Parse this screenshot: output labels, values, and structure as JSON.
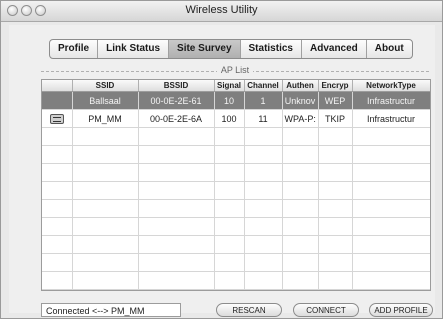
{
  "window": {
    "title": "Wireless Utility"
  },
  "tabs": [
    {
      "label": "Profile"
    },
    {
      "label": "Link Status"
    },
    {
      "label": "Site Survey",
      "active": true
    },
    {
      "label": "Statistics"
    },
    {
      "label": "Advanced"
    },
    {
      "label": "About"
    }
  ],
  "ap_list": {
    "label": "AP List",
    "columns": [
      "",
      "SSID",
      "BSSID",
      "Signal",
      "Channel",
      "Authen",
      "Encryp",
      "NetworkType"
    ],
    "rows": [
      {
        "icon": "",
        "ssid": "Ballsaal",
        "bssid": "00-0E-2E-61",
        "signal": "10",
        "channel": "1",
        "authen": "Unknov",
        "encryp": "WEP",
        "network_type": "Infrastructur",
        "selected": true
      },
      {
        "icon": "access-point-icon",
        "ssid": "PM_MM",
        "bssid": "00-0E-2E-6A",
        "signal": "100",
        "channel": "11",
        "authen": "WPA-P:",
        "encryp": "TKIP",
        "network_type": "Infrastructur",
        "selected": false
      }
    ]
  },
  "status": {
    "connection_text": "Connected <--> PM_MM"
  },
  "buttons": {
    "rescan": "RESCAN",
    "connect": "CONNECT",
    "add_profile": "ADD PROFILE"
  },
  "colors": {
    "selected_row": "#7f7f7f",
    "active_tab": "#bdbdbd"
  }
}
